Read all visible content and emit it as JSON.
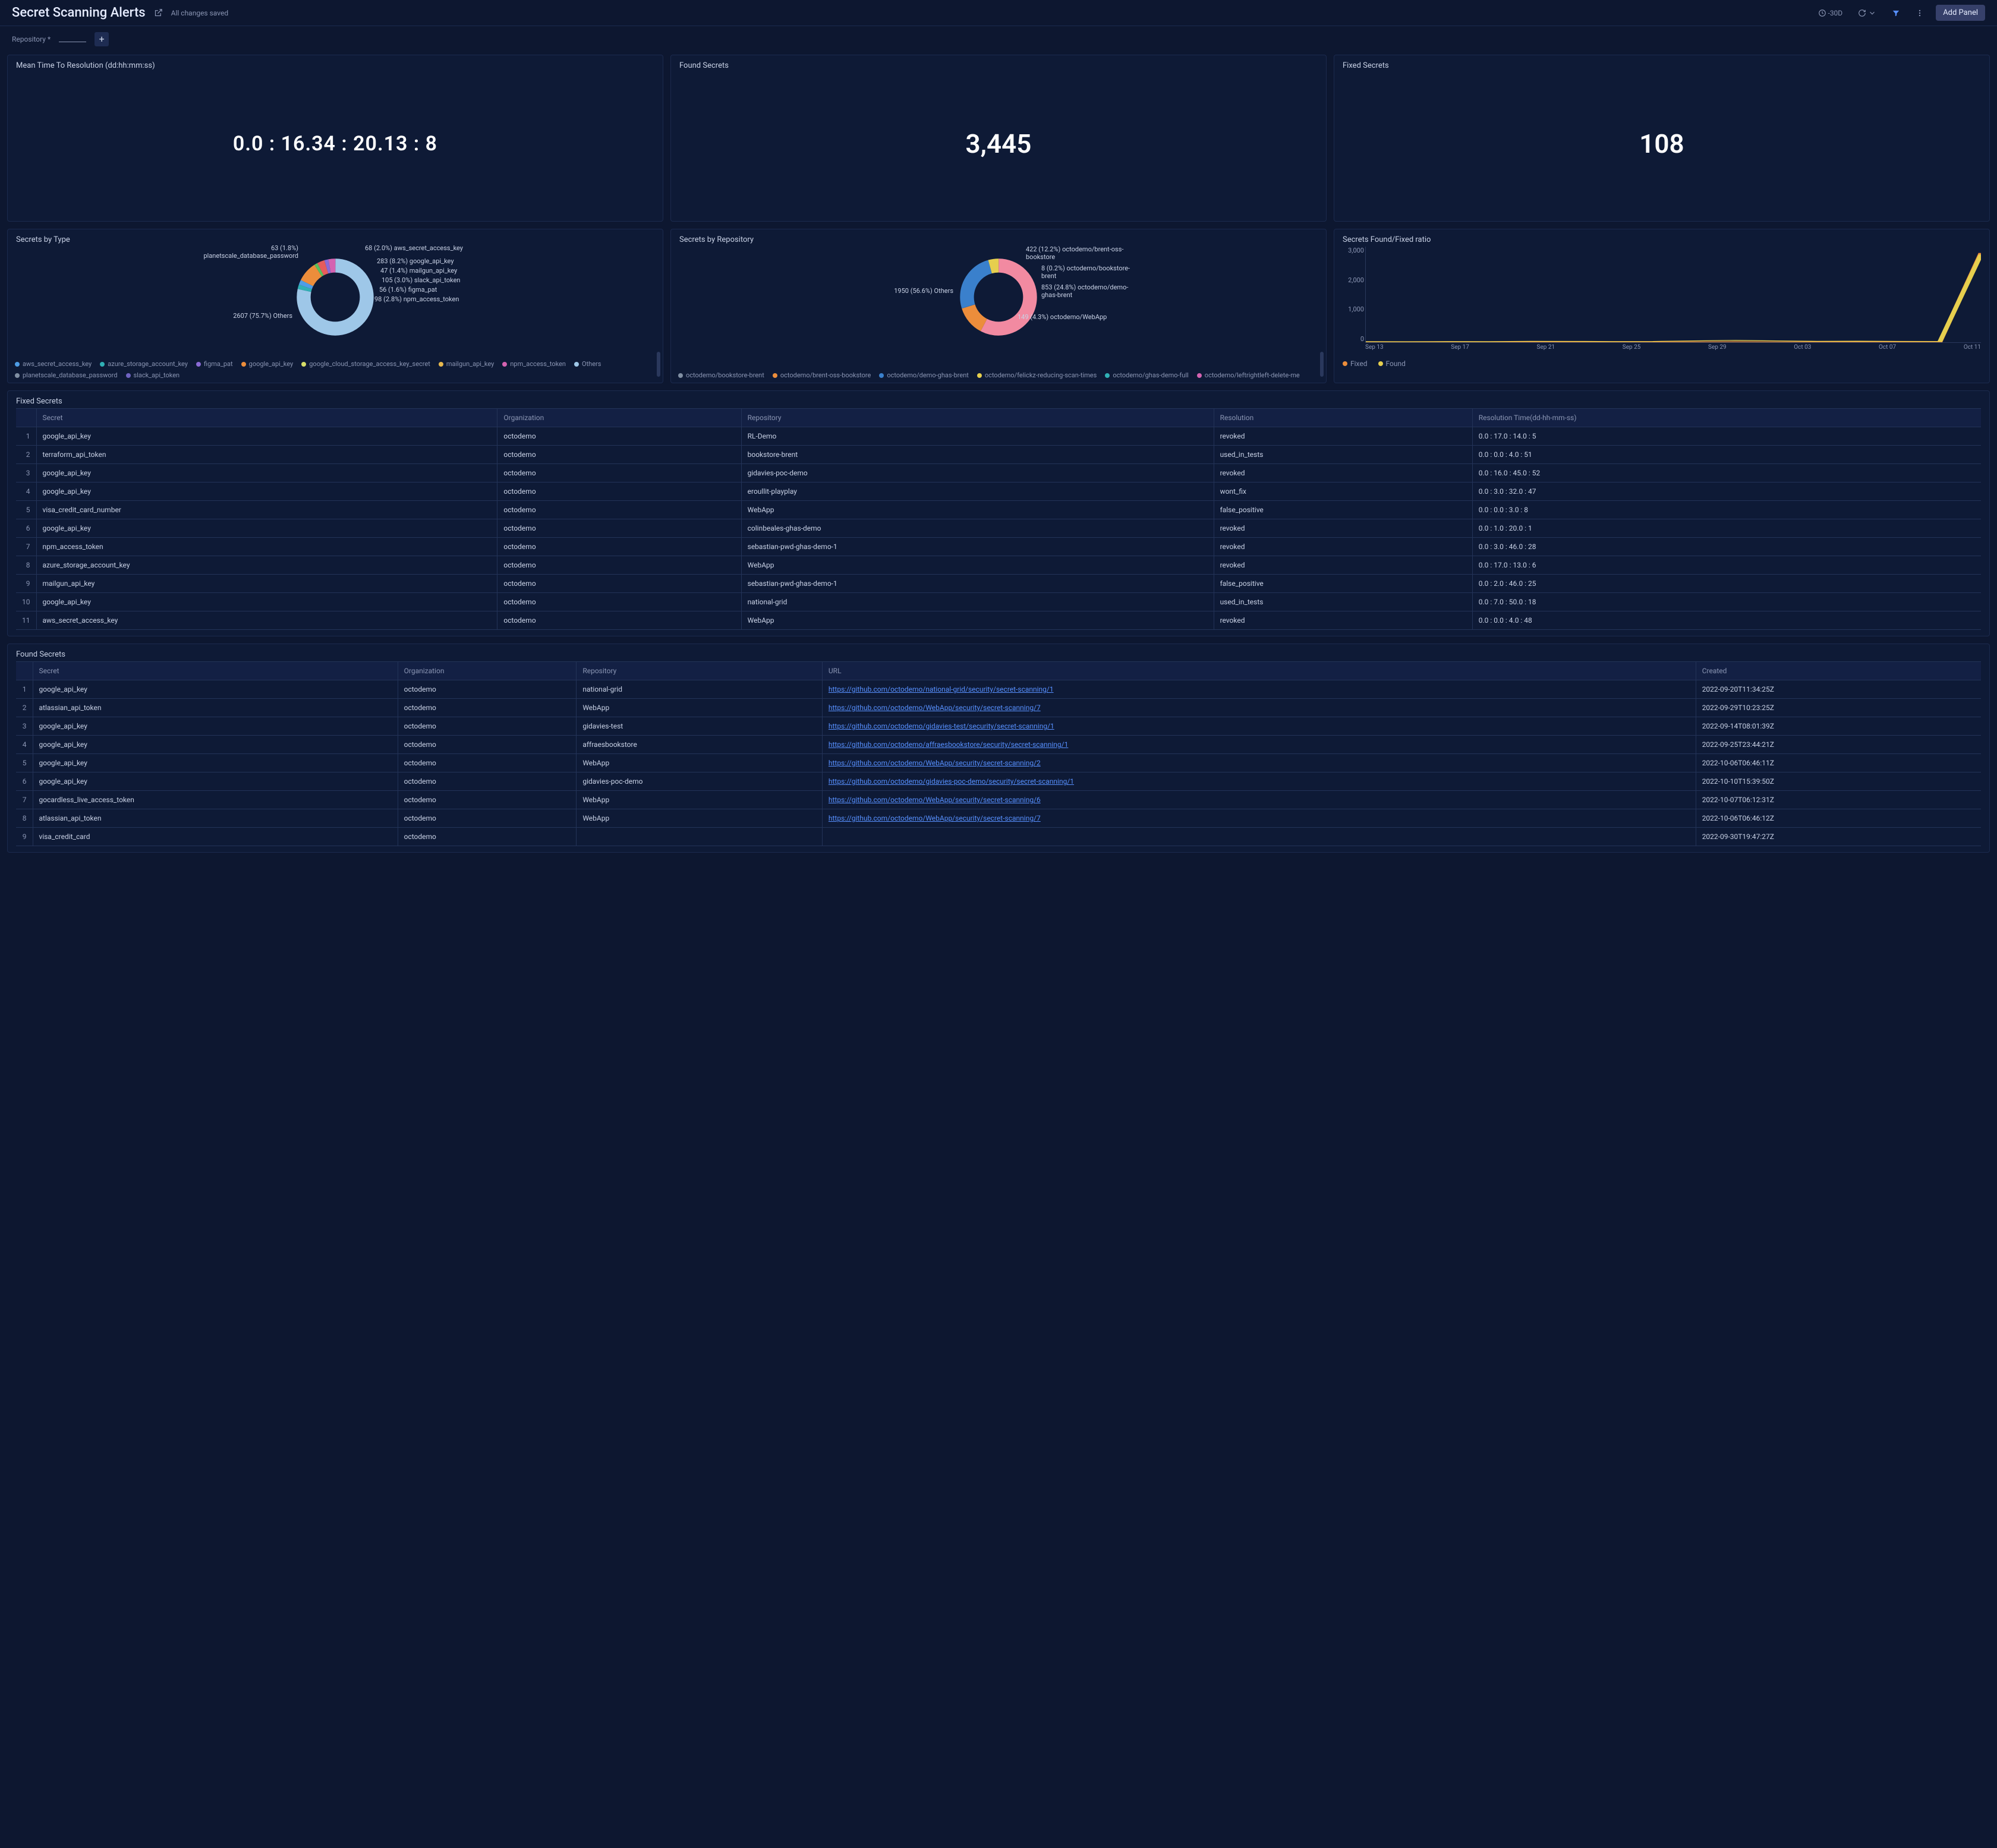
{
  "header": {
    "title": "Secret Scanning Alerts",
    "saved": "All changes saved",
    "time_range": "-30D",
    "add_panel": "Add Panel"
  },
  "variables": {
    "label": "Repository",
    "suffix": "*"
  },
  "stats": {
    "mttr": {
      "title": "Mean Time To Resolution (dd:hh:mm:ss)",
      "value": "0.0 : 16.34 : 20.13 : 8"
    },
    "found": {
      "title": "Found Secrets",
      "value": "3,445"
    },
    "fixed": {
      "title": "Fixed Secrets",
      "value": "108"
    }
  },
  "chart_data": [
    {
      "type": "pie",
      "title": "Secrets by Type",
      "series": [
        {
          "name": "Others",
          "value": 2607,
          "pct": "75.7%",
          "color": "#9ec7e8"
        },
        {
          "name": "planetscale_database_password",
          "value": 63,
          "pct": "1.8%",
          "color": "#30b0b5"
        },
        {
          "name": "aws_secret_access_key",
          "value": 68,
          "pct": "2.0%",
          "color": "#4e9de6"
        },
        {
          "name": "google_api_key",
          "value": 283,
          "pct": "8.2%",
          "color": "#ec8d3b"
        },
        {
          "name": "mailgun_api_key",
          "value": 47,
          "pct": "1.4%",
          "color": "#5bbf5b"
        },
        {
          "name": "slack_api_token",
          "value": 105,
          "pct": "3.0%",
          "color": "#e65c5c"
        },
        {
          "name": "figma_pat",
          "value": 56,
          "pct": "1.6%",
          "color": "#8a6ad6"
        },
        {
          "name": "npm_access_token",
          "value": 98,
          "pct": "2.8%",
          "color": "#d463b1"
        }
      ],
      "legend": [
        {
          "name": "aws_secret_access_key",
          "color": "#4e9de6"
        },
        {
          "name": "azure_storage_account_key",
          "color": "#30b0b5"
        },
        {
          "name": "figma_pat",
          "color": "#8a6ad6"
        },
        {
          "name": "google_api_key",
          "color": "#ec8d3b"
        },
        {
          "name": "google_cloud_storage_access_key_secret",
          "color": "#d6de68"
        },
        {
          "name": "mailgun_api_key",
          "color": "#e6b84e"
        },
        {
          "name": "npm_access_token",
          "color": "#d463b1"
        },
        {
          "name": "Others",
          "color": "#9ec7e8"
        },
        {
          "name": "planetscale_database_password",
          "color": "#808fa3"
        },
        {
          "name": "slack_api_token",
          "color": "#6f63c1"
        }
      ]
    },
    {
      "type": "pie",
      "title": "Secrets by Repository",
      "series": [
        {
          "name": "Others",
          "value": 1950,
          "pct": "56.6%",
          "color": "#f28aa1"
        },
        {
          "name": "octodemo/brent-oss-bookstore",
          "value": 422,
          "pct": "12.2%",
          "color": "#ec8d3b"
        },
        {
          "name": "octodemo/bookstore-brent",
          "value": 8,
          "pct": "0.2%",
          "color": "#3a80cc"
        },
        {
          "name": "octodemo/demo-ghas-brent",
          "value": 853,
          "pct": "24.8%",
          "color": "#3a80cc"
        },
        {
          "name": "octodemo/WebApp",
          "value": 149,
          "pct": "4.3%",
          "color": "#e6cf4e"
        }
      ],
      "legend": [
        {
          "name": "octodemo/bookstore-brent",
          "color": "#808fa3"
        },
        {
          "name": "octodemo/brent-oss-bookstore",
          "color": "#ec8d3b"
        },
        {
          "name": "octodemo/demo-ghas-brent",
          "color": "#3a80cc"
        },
        {
          "name": "octodemo/felickz-reducing-scan-times",
          "color": "#e6cf4e"
        },
        {
          "name": "octodemo/ghas-demo-full",
          "color": "#30b0b5"
        },
        {
          "name": "octodemo/leftrightleft-delete-me",
          "color": "#d463b1"
        }
      ]
    },
    {
      "type": "line",
      "title": "Secrets Found/Fixed ratio",
      "ylim": [
        0,
        3000
      ],
      "yticks": [
        "3,000",
        "2,000",
        "1,000",
        "0"
      ],
      "xticks": [
        "Sep 13",
        "Sep 17",
        "Sep 21",
        "Sep 25",
        "Sep 29",
        "Oct 03",
        "Oct 07",
        "Oct 11"
      ],
      "series": [
        {
          "name": "Fixed",
          "color": "#ec8d3b",
          "values": [
            5,
            4,
            6,
            5,
            10,
            8,
            6,
            7,
            12,
            15,
            10,
            8,
            9,
            7,
            6,
            2800
          ]
        },
        {
          "name": "Found",
          "color": "#e6cf4e",
          "values": [
            20,
            18,
            22,
            20,
            30,
            28,
            24,
            26,
            45,
            60,
            44,
            30,
            34,
            28,
            25,
            2750
          ]
        }
      ]
    }
  ],
  "fixed_table": {
    "title": "Fixed Secrets",
    "columns": [
      "",
      "Secret",
      "Organization",
      "Repository",
      "Resolution",
      "Resolution Time(dd-hh-mm-ss)"
    ],
    "rows": [
      [
        "1",
        "google_api_key",
        "octodemo",
        "RL-Demo",
        "revoked",
        "0.0 : 17.0 : 14.0 : 5"
      ],
      [
        "2",
        "terraform_api_token",
        "octodemo",
        "bookstore-brent",
        "used_in_tests",
        "0.0 : 0.0 : 4.0 : 51"
      ],
      [
        "3",
        "google_api_key",
        "octodemo",
        "gidavies-poc-demo",
        "revoked",
        "0.0 : 16.0 : 45.0 : 52"
      ],
      [
        "4",
        "google_api_key",
        "octodemo",
        "eroullit-playplay",
        "wont_fix",
        "0.0 : 3.0 : 32.0 : 47"
      ],
      [
        "5",
        "visa_credit_card_number",
        "octodemo",
        "WebApp",
        "false_positive",
        "0.0 : 0.0 : 3.0 : 8"
      ],
      [
        "6",
        "google_api_key",
        "octodemo",
        "colinbeales-ghas-demo",
        "revoked",
        "0.0 : 1.0 : 20.0 : 1"
      ],
      [
        "7",
        "npm_access_token",
        "octodemo",
        "sebastian-pwd-ghas-demo-1",
        "revoked",
        "0.0 : 3.0 : 46.0 : 28"
      ],
      [
        "8",
        "azure_storage_account_key",
        "octodemo",
        "WebApp",
        "revoked",
        "0.0 : 17.0 : 13.0 : 6"
      ],
      [
        "9",
        "mailgun_api_key",
        "octodemo",
        "sebastian-pwd-ghas-demo-1",
        "false_positive",
        "0.0 : 2.0 : 46.0 : 25"
      ],
      [
        "10",
        "google_api_key",
        "octodemo",
        "national-grid",
        "used_in_tests",
        "0.0 : 7.0 : 50.0 : 18"
      ],
      [
        "11",
        "aws_secret_access_key",
        "octodemo",
        "WebApp",
        "revoked",
        "0.0 : 0.0 : 4.0 : 48"
      ]
    ]
  },
  "found_table": {
    "title": "Found Secrets",
    "columns": [
      "",
      "Secret",
      "Organization",
      "Repository",
      "URL",
      "Created"
    ],
    "rows": [
      [
        "1",
        "google_api_key",
        "octodemo",
        "national-grid",
        "https://github.com/octodemo/national-grid/security/secret-scanning/1",
        "2022-09-20T11:34:25Z"
      ],
      [
        "2",
        "atlassian_api_token",
        "octodemo",
        "WebApp",
        "https://github.com/octodemo/WebApp/security/secret-scanning/7",
        "2022-09-29T10:23:25Z"
      ],
      [
        "3",
        "google_api_key",
        "octodemo",
        "gidavies-test",
        "https://github.com/octodemo/gidavies-test/security/secret-scanning/1",
        "2022-09-14T08:01:39Z"
      ],
      [
        "4",
        "google_api_key",
        "octodemo",
        "affraesbookstore",
        "https://github.com/octodemo/affraesbookstore/security/secret-scanning/1",
        "2022-09-25T23:44:21Z"
      ],
      [
        "5",
        "google_api_key",
        "octodemo",
        "WebApp",
        "https://github.com/octodemo/WebApp/security/secret-scanning/2",
        "2022-10-06T06:46:11Z"
      ],
      [
        "6",
        "google_api_key",
        "octodemo",
        "gidavies-poc-demo",
        "https://github.com/octodemo/gidavies-poc-demo/security/secret-scanning/1",
        "2022-10-10T15:39:50Z"
      ],
      [
        "7",
        "gocardless_live_access_token",
        "octodemo",
        "WebApp",
        "https://github.com/octodemo/WebApp/security/secret-scanning/6",
        "2022-10-07T06:12:31Z"
      ],
      [
        "8",
        "atlassian_api_token",
        "octodemo",
        "WebApp",
        "https://github.com/octodemo/WebApp/security/secret-scanning/7",
        "2022-10-06T06:46:12Z"
      ],
      [
        "9",
        "visa_credit_card",
        "octodemo",
        "",
        "",
        "2022-09-30T19:47:27Z"
      ]
    ]
  }
}
